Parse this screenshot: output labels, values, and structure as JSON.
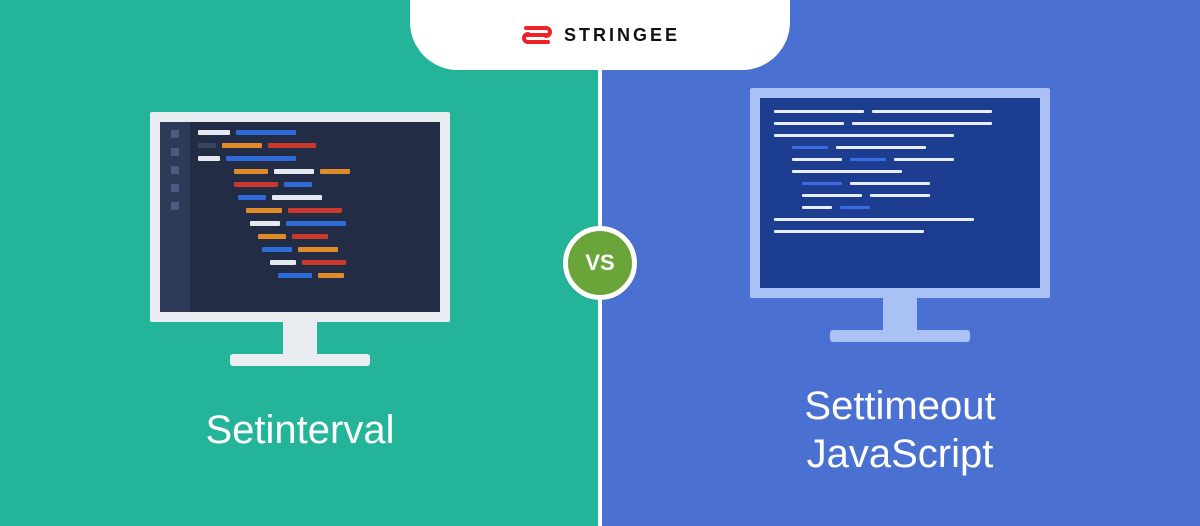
{
  "brand": {
    "name": "STRINGEE",
    "icon": "stringee-logo-icon",
    "accent": "#ec2227"
  },
  "vs_label": "VS",
  "left": {
    "caption": "Setinterval",
    "bg": "#24b49a",
    "monitor_frame": "#e9edf2",
    "screen_bg": "#222d45"
  },
  "right": {
    "caption": "Settimeout\nJavaScript",
    "bg": "#4a71d1",
    "monitor_frame": "#a9c2f3",
    "screen_bg": "#1c3d90"
  }
}
